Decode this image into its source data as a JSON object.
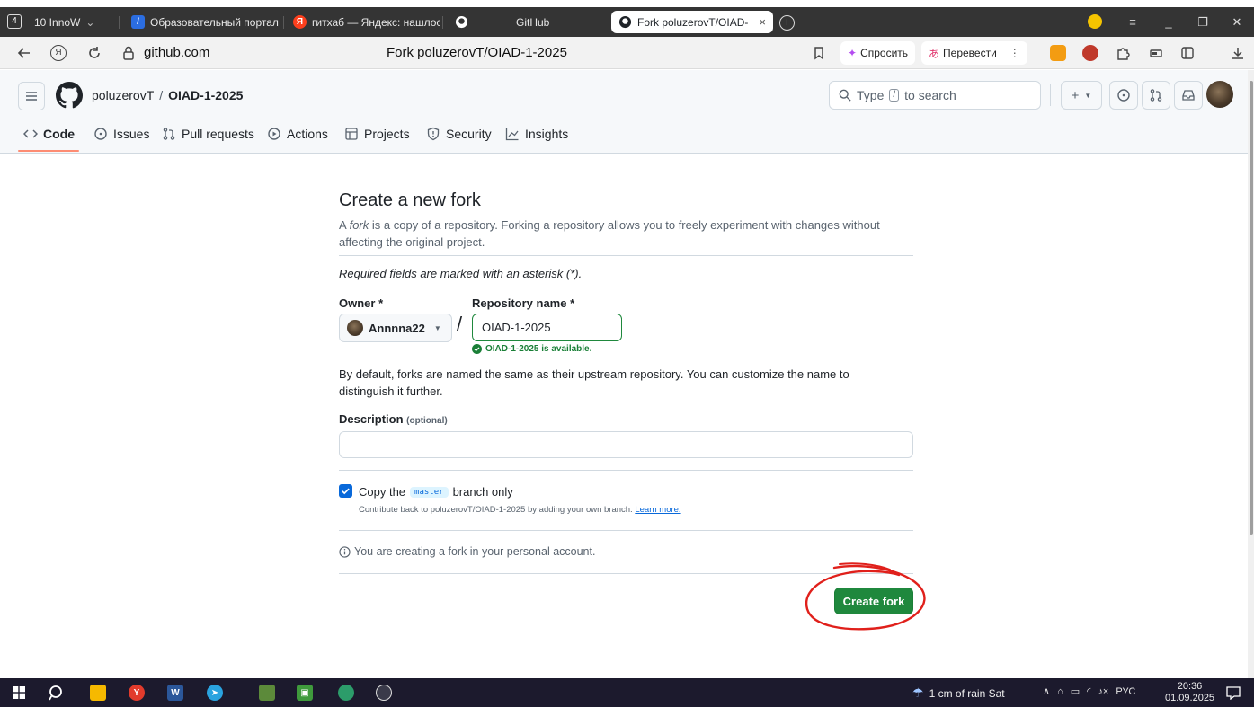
{
  "browser": {
    "tab_counter": "4",
    "tabs": [
      {
        "label": "10 InnoW",
        "favicon_color": "#ffffff"
      },
      {
        "label": "Образовательный портал",
        "favicon_color": "#2b6de0"
      },
      {
        "label": "гитхаб — Яндекс: нашлос",
        "favicon_color": "#fc3f1d"
      },
      {
        "label": "",
        "favicon_color": "#ffffff"
      },
      {
        "label": "GitHub",
        "favicon_color": "#ffffff"
      },
      {
        "label": "Fork poluzerovT/OIAD-",
        "favicon_color": "#1f2328"
      }
    ],
    "domain": "github.com",
    "page_title": "Fork poluzerovT/OIAD-1-2025",
    "ask_label": "Спросить",
    "translate_label": "Перевести"
  },
  "header": {
    "owner_crumb": "poluzerovT",
    "separator": "/",
    "repo_crumb": "OIAD-1-2025",
    "search_before": "Type",
    "search_key": "/",
    "search_after": "to search"
  },
  "repo_tabs": [
    "Code",
    "Issues",
    "Pull requests",
    "Actions",
    "Projects",
    "Security",
    "Insights"
  ],
  "form": {
    "title": "Create a new fork",
    "intro_a": "A",
    "intro_fork": "fork",
    "intro_b": "is a copy of a repository. Forking a repository allows you to freely experiment with changes without affecting the original project.",
    "required_note": "Required fields are marked with an asterisk (*).",
    "owner_label": "Owner *",
    "owner_value": "Annnna22",
    "slash": "/",
    "repo_label": "Repository name *",
    "repo_value": "OIAD-1-2025",
    "available_msg": "OIAD-1-2025 is available.",
    "default_note": "By default, forks are named the same as their upstream repository. You can customize the name to distinguish it further.",
    "description_label": "Description",
    "description_optional": "(optional)",
    "description_value": "",
    "copy_a": "Copy the",
    "copy_branch": "master",
    "copy_b": "branch only",
    "copy_checked": true,
    "contribute_text": "Contribute back to poluzerovT/OIAD-1-2025 by adding your own branch.",
    "learn_more": "Learn more.",
    "personal_note": "You are creating a fork in your personal account.",
    "create_button": "Create fork"
  },
  "taskbar": {
    "weather": "1 cm of rain Sat",
    "lang": "РУС",
    "time": "20:36",
    "date": "01.09.2025"
  },
  "colors": {
    "primary_button": "#1f883d",
    "success_text": "#1a7f37",
    "link": "#0969da",
    "annotation_red": "#e0201b",
    "underline_accent": "#fd8c73"
  }
}
